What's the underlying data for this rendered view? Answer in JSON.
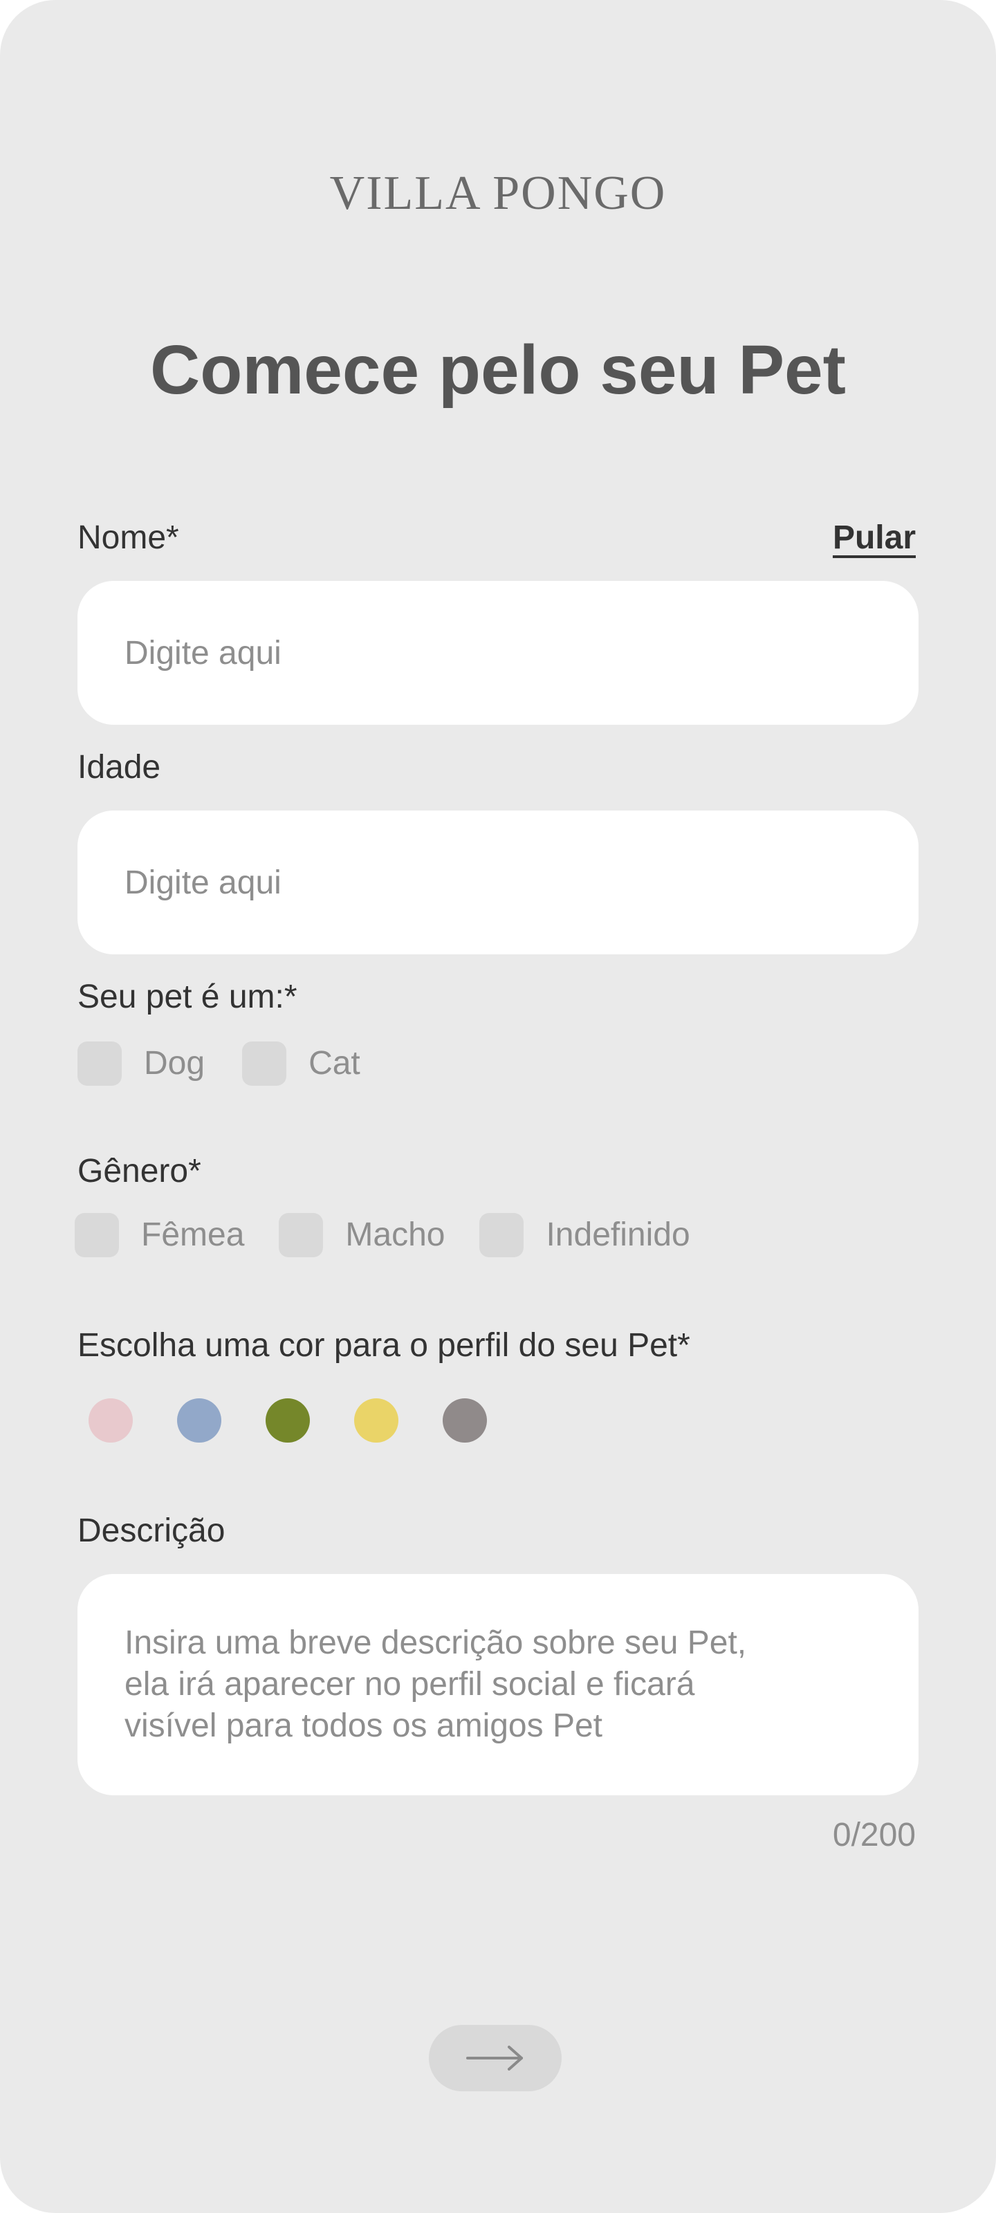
{
  "brand": {
    "logo_text": "VILLA PONGO"
  },
  "page": {
    "title": "Comece pelo seu Pet"
  },
  "form": {
    "name": {
      "label": "Nome*",
      "placeholder": "Digite aqui",
      "value": ""
    },
    "skip_label": "Pular",
    "age": {
      "label": "Idade",
      "placeholder": "Digite aqui",
      "value": ""
    },
    "species": {
      "label": "Seu pet é um:*",
      "options": [
        {
          "label": "Dog",
          "checked": false
        },
        {
          "label": "Cat",
          "checked": false
        }
      ]
    },
    "gender": {
      "label": "Gênero*",
      "options": [
        {
          "label": "Fêmea",
          "checked": false
        },
        {
          "label": "Macho",
          "checked": false
        },
        {
          "label": "Indefinido",
          "checked": false
        }
      ]
    },
    "profile_color": {
      "label": "Escolha uma cor para o perfil do seu Pet*",
      "colors": [
        "#e8c9cd",
        "#92a8c9",
        "#75872a",
        "#ead468",
        "#908a8a"
      ]
    },
    "description": {
      "label": "Descrição",
      "placeholder": "Insira uma breve descrição sobre seu Pet,\nela irá aparecer no perfil social e ficará\nvisível para todos os amigos Pet",
      "value": "",
      "counter": "0/200"
    }
  },
  "footer": {
    "next_icon": "arrow-right-icon"
  },
  "theme": {
    "background": "#eaeaea",
    "input_background": "#ffffff",
    "control_gray": "#d9d9d9",
    "text_dark": "#333333",
    "text_muted": "#8e8e8e",
    "title_color": "#555555"
  }
}
